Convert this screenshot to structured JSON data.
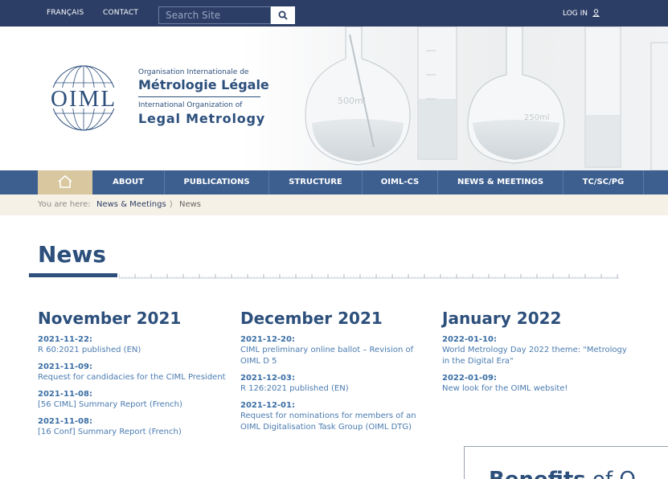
{
  "topbar": {
    "lang_link": "FRANÇAIS",
    "contact_link": "CONTACT",
    "search_placeholder": "Search Site",
    "login_link": "LOG IN"
  },
  "logo": {
    "mark": "OIML",
    "org_line1": "Organisation Internationale de",
    "org_line2": "Métrologie Légale",
    "org_line3": "International Organization of",
    "org_line4": "Legal Metrology"
  },
  "banner": {
    "flask_label1": "500ml",
    "flask_label2": "250ml"
  },
  "nav": {
    "items": [
      "ABOUT",
      "PUBLICATIONS",
      "STRUCTURE",
      "OIML-CS",
      "NEWS & MEETINGS",
      "TC/SC/PG"
    ]
  },
  "breadcrumb": {
    "label": "You are here:",
    "parent": "News & Meetings",
    "separator": "⟩",
    "current": "News"
  },
  "page_title": "News",
  "columns": [
    {
      "month": "November 2021",
      "entries": [
        {
          "date": "2021-11-22:",
          "text": "R 60:2021 published (EN)"
        },
        {
          "date": "2021-11-09:",
          "text": "Request for candidacies for the CIML President"
        },
        {
          "date": "2021-11-08:",
          "text": "[56 CIML] Summary Report (French)"
        },
        {
          "date": "2021-11-08:",
          "text": "[16 Conf] Summary Report (French)"
        }
      ]
    },
    {
      "month": "December 2021",
      "entries": [
        {
          "date": "2021-12-20:",
          "text": "CIML preliminary online ballot – Revision of OIML D 5"
        },
        {
          "date": "2021-12-03:",
          "text": "R 126:2021 published (EN)"
        },
        {
          "date": "2021-12-01:",
          "text": "Request for nominations for members of an OIML Digitalisation Task Group (OIML DTG)"
        }
      ]
    },
    {
      "month": "January 2022",
      "entries": [
        {
          "date": "2022-01-10:",
          "text": "World Metrology Day 2022 theme: \"Metrology in the Digital Era\""
        },
        {
          "date": "2022-01-09:",
          "text": "New look for the OIML website!"
        }
      ]
    }
  ],
  "benefits": {
    "bold": "Benefits",
    "rest": " of O"
  },
  "colors": {
    "topbar": "#2c3e66",
    "nav": "#3d5f8f",
    "home_tab": "#d9c79f",
    "crumb_bg": "#f6f1e6",
    "heading": "#2c4f7c",
    "link": "#4a7bb0"
  }
}
